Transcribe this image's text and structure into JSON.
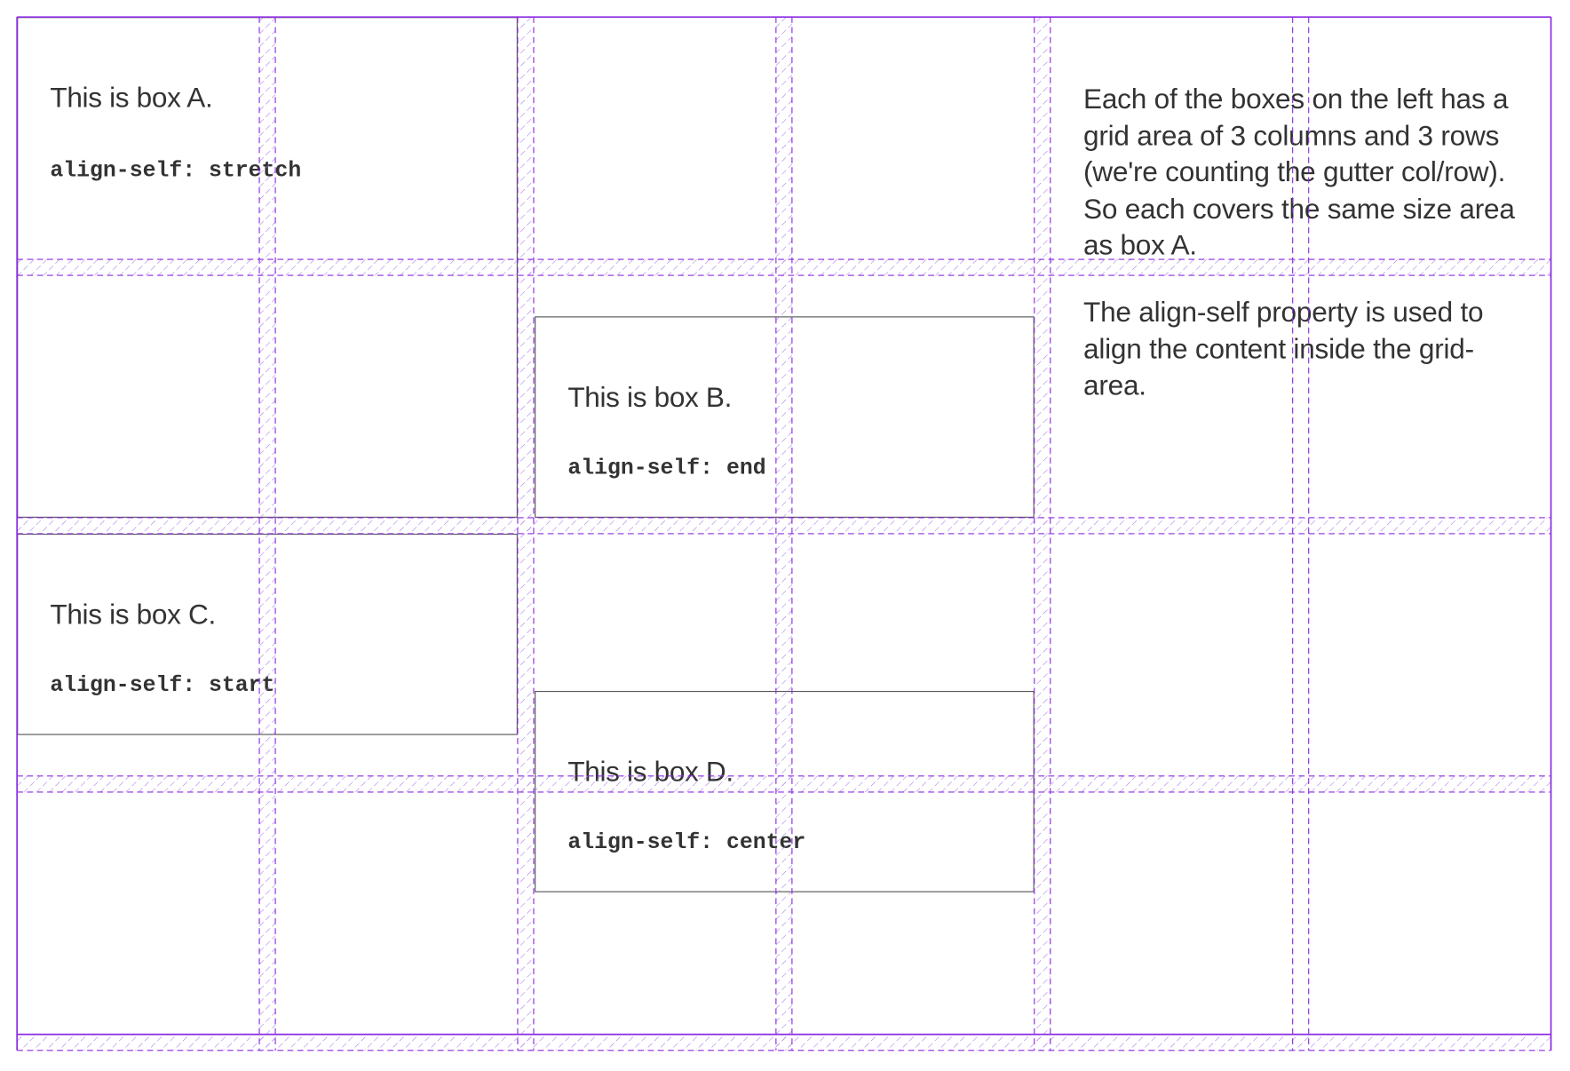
{
  "boxes": {
    "a": {
      "title": "This is box A.",
      "code": "align-self: stretch"
    },
    "b": {
      "title": "This is box B.",
      "code": "align-self: end"
    },
    "c": {
      "title": "This is box C.",
      "code": "align-self: start"
    },
    "d": {
      "title": "This is box D.",
      "code": "align-self: center"
    }
  },
  "description": {
    "para1": "Each of the boxes on the left has a grid area of 3 columns and 3 rows (we're counting the gutter col/row). So each covers the same size area as box A.",
    "para2": "The align-self property is used to align the content inside the grid-area."
  },
  "colors": {
    "grid_overlay": "#8a2be2",
    "box_border": "#555555",
    "text": "#333333"
  }
}
